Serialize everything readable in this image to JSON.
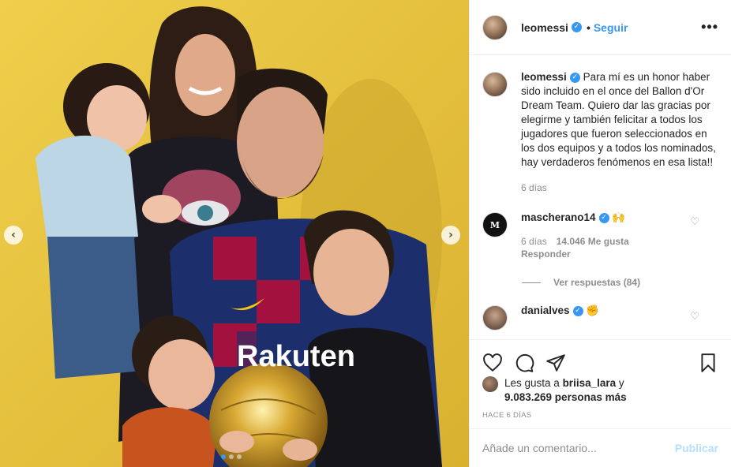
{
  "header": {
    "username": "leomessi",
    "separator": "•",
    "follow_label": "Seguir",
    "more_label": "•••"
  },
  "caption": {
    "username": "leomessi",
    "text": "Para mí es un honor haber sido incluido en el once del Ballon d'Or Dream Team. Quiero dar las gracias por elegirme y también felicitar a todos los jugadores que fueron seleccionados en los dos equipos y a todos los nominados, hay verdaderos fenómenos en esa lista!!",
    "age": "6 días"
  },
  "comments": [
    {
      "username": "mascherano14",
      "emoji": "🙌",
      "age": "6 días",
      "likes": "14.046 Me gusta",
      "reply_label": "Responder",
      "view_replies": "Ver respuestas (84)",
      "avatar_letter": "M"
    },
    {
      "username": "danialves",
      "emoji": "✊"
    }
  ],
  "likes": {
    "prefix": "Les gusta a ",
    "user": "briisa_lara",
    "conj": " y ",
    "count": "9.083.269 personas más"
  },
  "timestamp": "HACE 6 DÍAS",
  "add_comment": {
    "placeholder": "Añade un comentario...",
    "post_label": "Publicar"
  },
  "photo": {
    "shirt_text": "Rakuten",
    "prev_arrow": "‹",
    "next_arrow": "›",
    "carousel_total": 3,
    "carousel_active": 1
  },
  "colors": {
    "accent": "#3897f0",
    "background_yellow": "#e8c23a"
  }
}
